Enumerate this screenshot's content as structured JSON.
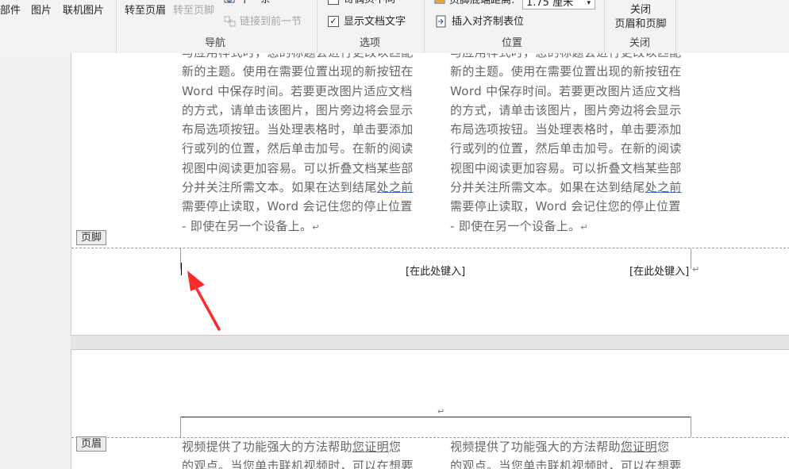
{
  "ribbon": {
    "insert_group": {
      "part_label": "部件",
      "picture_label": "图片",
      "online_picture_label": "联机图片"
    },
    "navigation": {
      "goto_header": "转至页眉",
      "goto_footer": "转至页脚",
      "next": "下一条",
      "link_previous": "链接到前一节",
      "group_label": "导航"
    },
    "options": {
      "odd_even_diff": "奇偶页不同",
      "show_doc_text": "显示文档文字",
      "show_doc_text_checked": "✓",
      "group_label": "选项"
    },
    "position": {
      "footer_distance_label": "页脚底端距离:",
      "footer_distance_value": "1.75 厘米",
      "insert_align_tab": "插入对齐制表位",
      "group_label": "位置"
    },
    "close": {
      "close_label": "关闭",
      "close_label2": "页眉和页脚",
      "group_label": "关闭"
    }
  },
  "document": {
    "page1": {
      "col_lines": [
        "与应用样式时，您的标题会进行更改以匹配",
        "新的主题。使用在需要位置出现的新按钮在",
        "Word 中保存时间。若要更改图片适应文档",
        "的方式，请单击该图片，图片旁边将会显示",
        "布局选项按钮。当处理表格时，单击要添加",
        "行或列的位置，然后单击加号。在新的阅读",
        "视图中阅读更加容易。可以折叠文档某些部",
        "分并关注所需文本。如果在达到结尾",
        "需要停止读取，Word 会记住您的停止位置",
        "- 即使在另一个设备上。"
      ],
      "link_before_ending": "处之前",
      "return_mark": "↵",
      "footer_tab": "页脚",
      "footer_placeholder_center": "[在此处键入]",
      "footer_placeholder_right": "[在此处键入]"
    },
    "page2": {
      "header_tab": "页眉",
      "col_line1_prefix": "视频提供了功能强大的方法帮助",
      "col_line1_link": "您证明",
      "col_line1_suffix": "您",
      "col_line2": "的观点。当您单击联机视频时，可以在想要"
    }
  }
}
